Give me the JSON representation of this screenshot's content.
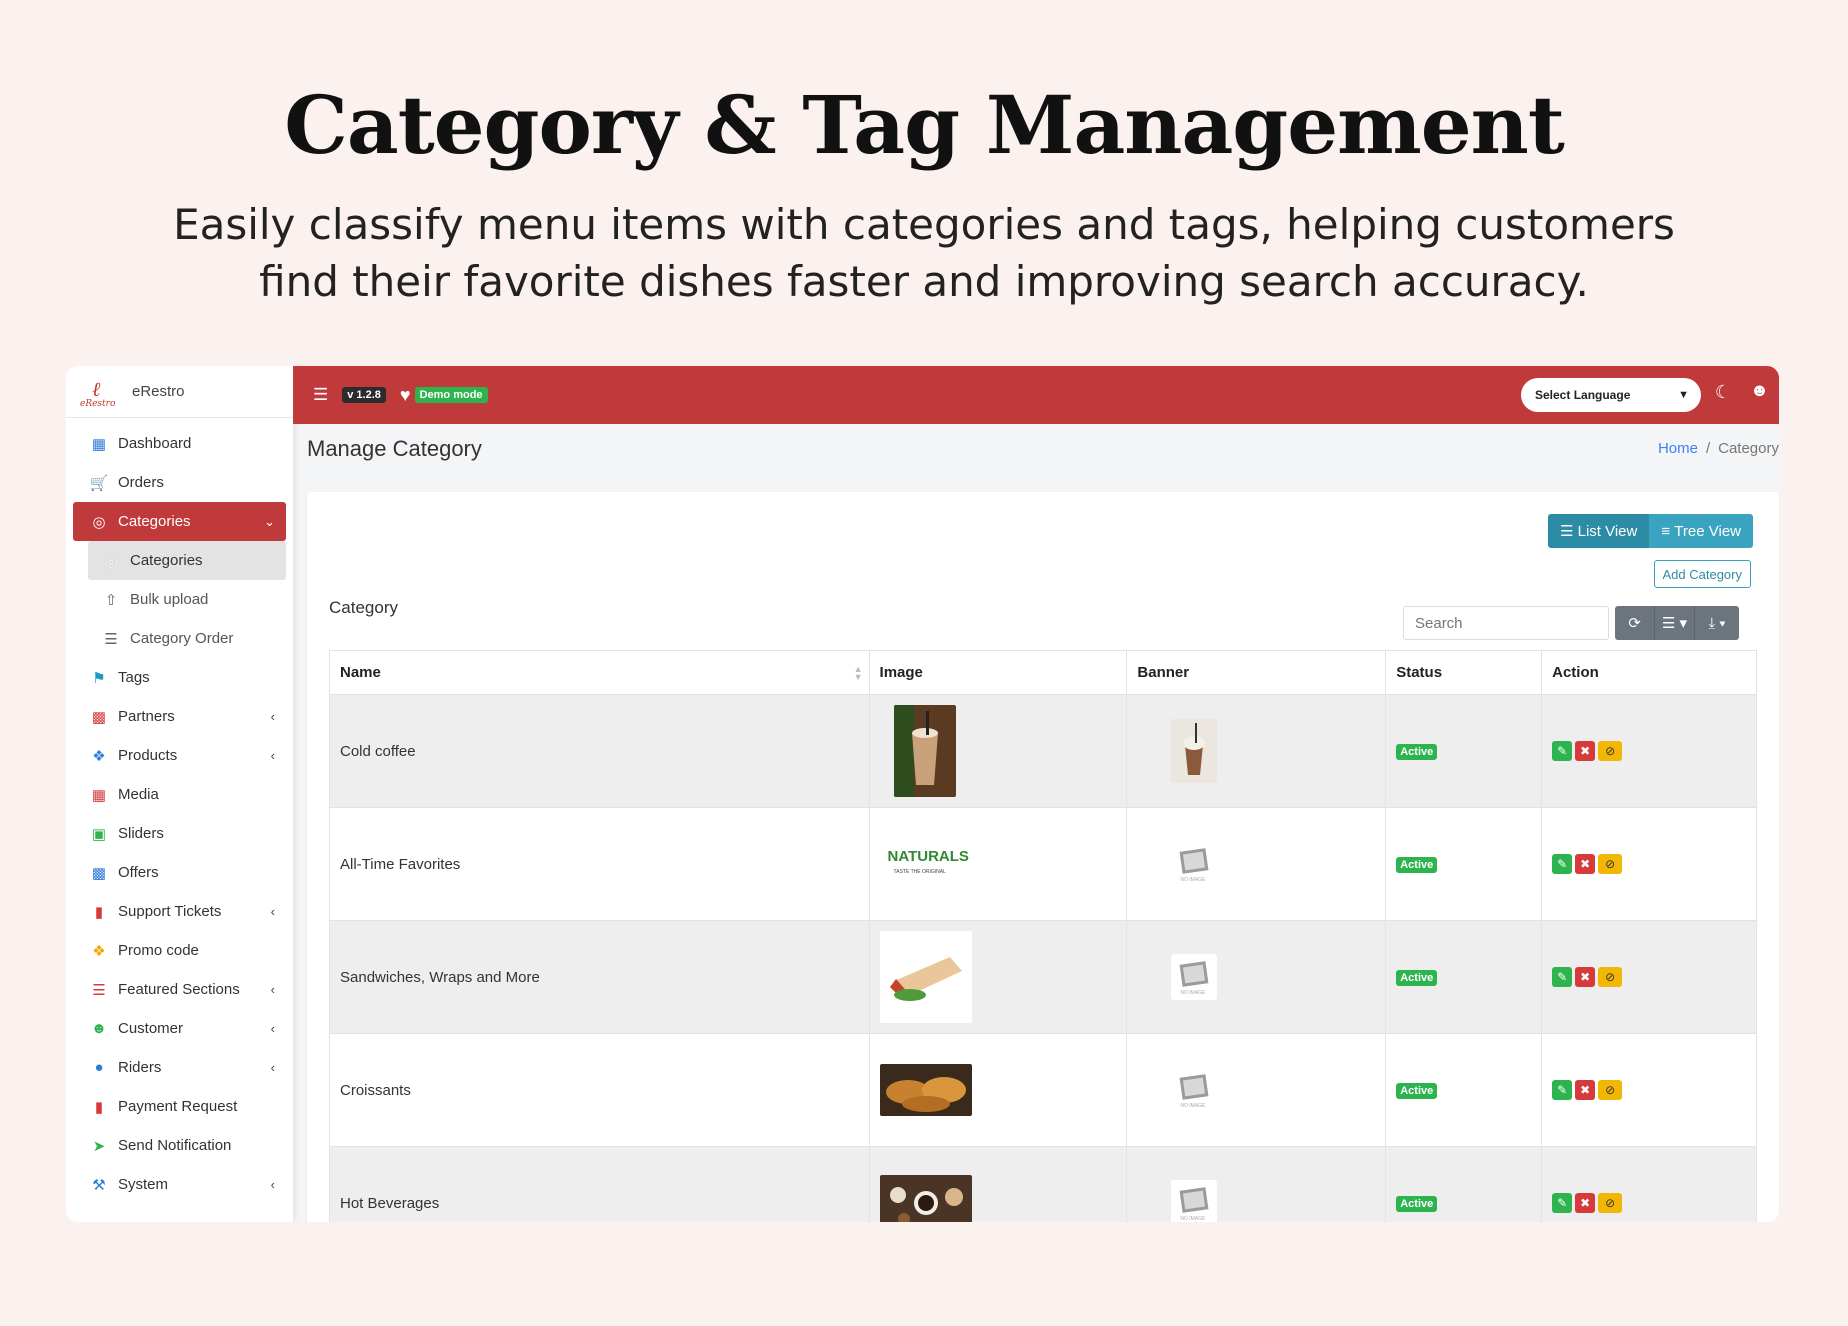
{
  "hero": {
    "title": "Category & Tag Management",
    "subtitle": "Easily classify menu items with categories and tags, helping customers find their favorite dishes faster and improving search accuracy."
  },
  "brand": {
    "name": "eRestro",
    "logo_word": "eRestro"
  },
  "topbar": {
    "version": "v 1.2.8",
    "demo": "Demo mode",
    "language": "Select Language"
  },
  "sidebar": {
    "items": [
      {
        "label": "Dashboard",
        "icon": "dashboard-icon"
      },
      {
        "label": "Orders",
        "icon": "cart-icon"
      },
      {
        "label": "Categories",
        "icon": "target-icon"
      },
      {
        "label": "Categories",
        "icon": "circle-icon"
      },
      {
        "label": "Bulk upload",
        "icon": "upload-icon"
      },
      {
        "label": "Category Order",
        "icon": "list-icon"
      },
      {
        "label": "Tags",
        "icon": "tag-icon"
      },
      {
        "label": "Partners",
        "icon": "store-icon"
      },
      {
        "label": "Products",
        "icon": "cubes-icon"
      },
      {
        "label": "Media",
        "icon": "media-icon"
      },
      {
        "label": "Sliders",
        "icon": "image-icon"
      },
      {
        "label": "Offers",
        "icon": "gift-icon"
      },
      {
        "label": "Support Tickets",
        "icon": "ticket-icon"
      },
      {
        "label": "Promo code",
        "icon": "puzzle-icon"
      },
      {
        "label": "Featured Sections",
        "icon": "layers-icon"
      },
      {
        "label": "Customer",
        "icon": "user-icon"
      },
      {
        "label": "Riders",
        "icon": "bike-icon"
      },
      {
        "label": "Payment Request",
        "icon": "money-icon"
      },
      {
        "label": "Send Notification",
        "icon": "send-icon"
      },
      {
        "label": "System",
        "icon": "wrench-icon"
      }
    ]
  },
  "page": {
    "title": "Manage Category",
    "breadcrumb_home": "Home",
    "breadcrumb_current": "Category"
  },
  "card": {
    "list_view": "List View",
    "tree_view": "Tree View",
    "add_category": "Add Category",
    "label": "Category",
    "search_placeholder": "Search"
  },
  "table": {
    "headers": [
      "Name",
      "Image",
      "Banner",
      "Status",
      "Action"
    ],
    "rows": [
      {
        "name": "Cold coffee",
        "status": "Active"
      },
      {
        "name": "All-Time Favorites",
        "status": "Active"
      },
      {
        "name": "Sandwiches, Wraps and More",
        "status": "Active"
      },
      {
        "name": "Croissants",
        "status": "Active"
      },
      {
        "name": "Hot Beverages",
        "status": "Active"
      }
    ],
    "naturals_logo": "NATURALS",
    "naturals_tag": "TASTE THE ORIGINAL",
    "no_image": "NO IMAGE"
  },
  "colors": {
    "brand_red": "#c0393b",
    "active_green": "#2eb44f",
    "teal": "#2d8ca5"
  }
}
